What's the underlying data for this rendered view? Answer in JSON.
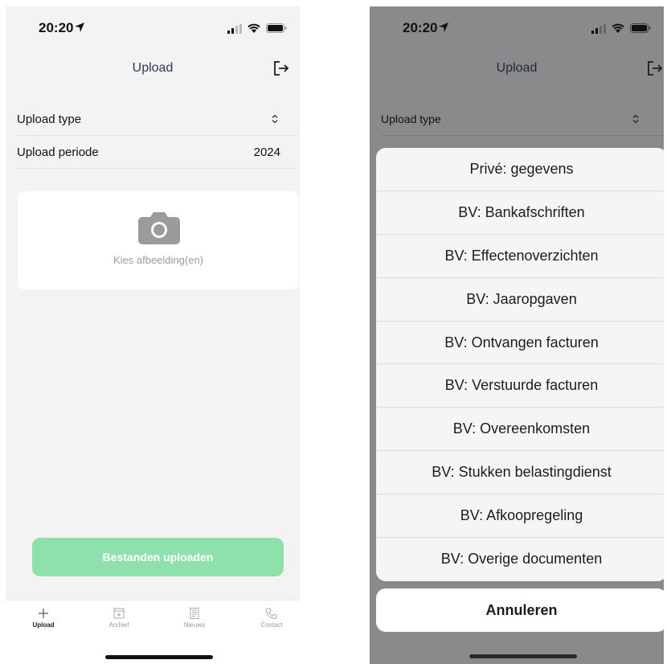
{
  "status": {
    "time": "20:20"
  },
  "nav": {
    "title": "Upload"
  },
  "form": {
    "upload_type_label": "Upload type",
    "upload_period_label": "Upload periode",
    "upload_period_value": "2024"
  },
  "image_picker": {
    "label": "Kies afbeelding(en)"
  },
  "upload_button": {
    "label": "Bestanden uploaden"
  },
  "tabs": [
    {
      "label": "Upload",
      "icon": "plus-icon",
      "active": true
    },
    {
      "label": "Archief",
      "icon": "archive-icon",
      "active": false
    },
    {
      "label": "Nieuws",
      "icon": "news-icon",
      "active": false
    },
    {
      "label": "Contact",
      "icon": "phone-icon",
      "active": false
    }
  ],
  "action_sheet": {
    "options": [
      "Privé: gegevens",
      "BV: Bankafschriften",
      "BV: Effectenoverzichten",
      "BV: Jaaropgaven",
      "BV: Ontvangen facturen",
      "BV: Verstuurde facturen",
      "BV: Overeenkomsten",
      "BV: Stukken belastingdienst",
      "BV: Afkoopregeling",
      "BV: Overige documenten"
    ],
    "cancel": "Annuleren"
  },
  "colors": {
    "upload_button": "#8fe1ac",
    "dim_overlay": "#8a8a8c",
    "title_text": "#2b3b4f"
  }
}
